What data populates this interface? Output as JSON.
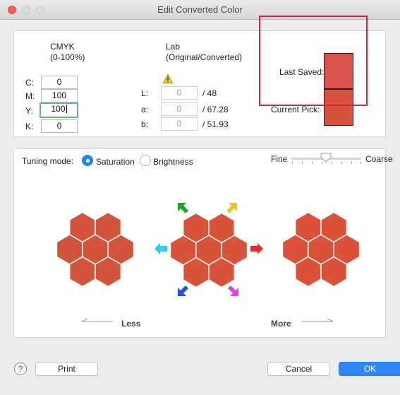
{
  "window": {
    "title": "Edit Converted Color"
  },
  "cmyk": {
    "header": "CMYK",
    "subheader": "(0-100%)",
    "labels": {
      "c": "C:",
      "m": "M:",
      "y": "Y:",
      "k": "K:"
    },
    "values": {
      "c": "0",
      "m": "100",
      "y": "100",
      "k": "0"
    }
  },
  "lab": {
    "header": "Lab",
    "subheader": "(Original/Converted)",
    "labels": {
      "l": "L:",
      "a": "a:",
      "b": "b:"
    },
    "converted": {
      "l": "0",
      "a": "0",
      "b": "0"
    },
    "original": {
      "l": "/ 48",
      "a": "/ 67.28",
      "b": "/ 51.93"
    }
  },
  "swatches": {
    "last_saved_label": "Last Saved:",
    "current_pick_label": "Current Pick:",
    "last_saved_color": "#db534d",
    "current_pick_color": "#d9523c"
  },
  "tuning": {
    "label": "Tuning mode:",
    "options": [
      "Saturation",
      "Brightness"
    ],
    "selected": "Saturation",
    "fine_label": "Fine",
    "coarse_label": "Coarse",
    "slider_value_fraction": 0.45
  },
  "hexagons": {
    "less_label": "Less",
    "more_label": "More",
    "left_color": "#d1543b",
    "center_color": "#d9523a",
    "right_color": "#dc513a",
    "arrow_colors": {
      "up_left": "#1fa32c",
      "up_right": "#e8c81e",
      "left": "#2ad4e6",
      "right": "#ec2e22",
      "down_left": "#2553d9",
      "down_right": "#e040e3"
    }
  },
  "footer": {
    "help_symbol": "?",
    "print_label": "Print",
    "cancel_label": "Cancel",
    "ok_label": "OK"
  }
}
